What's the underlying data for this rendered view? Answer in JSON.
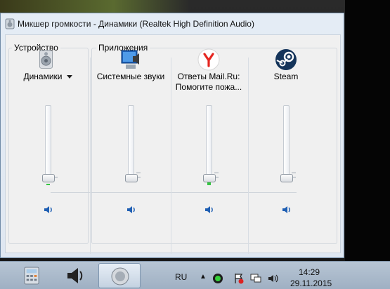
{
  "window": {
    "title": "Микшер громкости - Динамики (Realtek High Definition Audio)"
  },
  "device_group": {
    "label": "Устройство",
    "device": {
      "name": "Динамики",
      "icon": "speaker-device-icon",
      "volume": 0.0,
      "peak": 0.0
    }
  },
  "apps_group": {
    "label": "Приложения",
    "apps": [
      {
        "line1": "Системные звуки",
        "line2": "",
        "icon": "system-sounds-icon",
        "volume": 0.0,
        "peak": 0.0
      },
      {
        "line1": "Ответы Mail.Ru:",
        "line2": "Помогите пожа...",
        "icon": "yandex-browser-icon",
        "volume": 0.0,
        "peak": 0.02
      },
      {
        "line1": "Steam",
        "line2": "",
        "icon": "steam-icon",
        "volume": 0.0,
        "peak": 0.0
      }
    ]
  },
  "taskbar": {
    "language": "RU",
    "time": "14:29",
    "date": "29.11.2015"
  }
}
